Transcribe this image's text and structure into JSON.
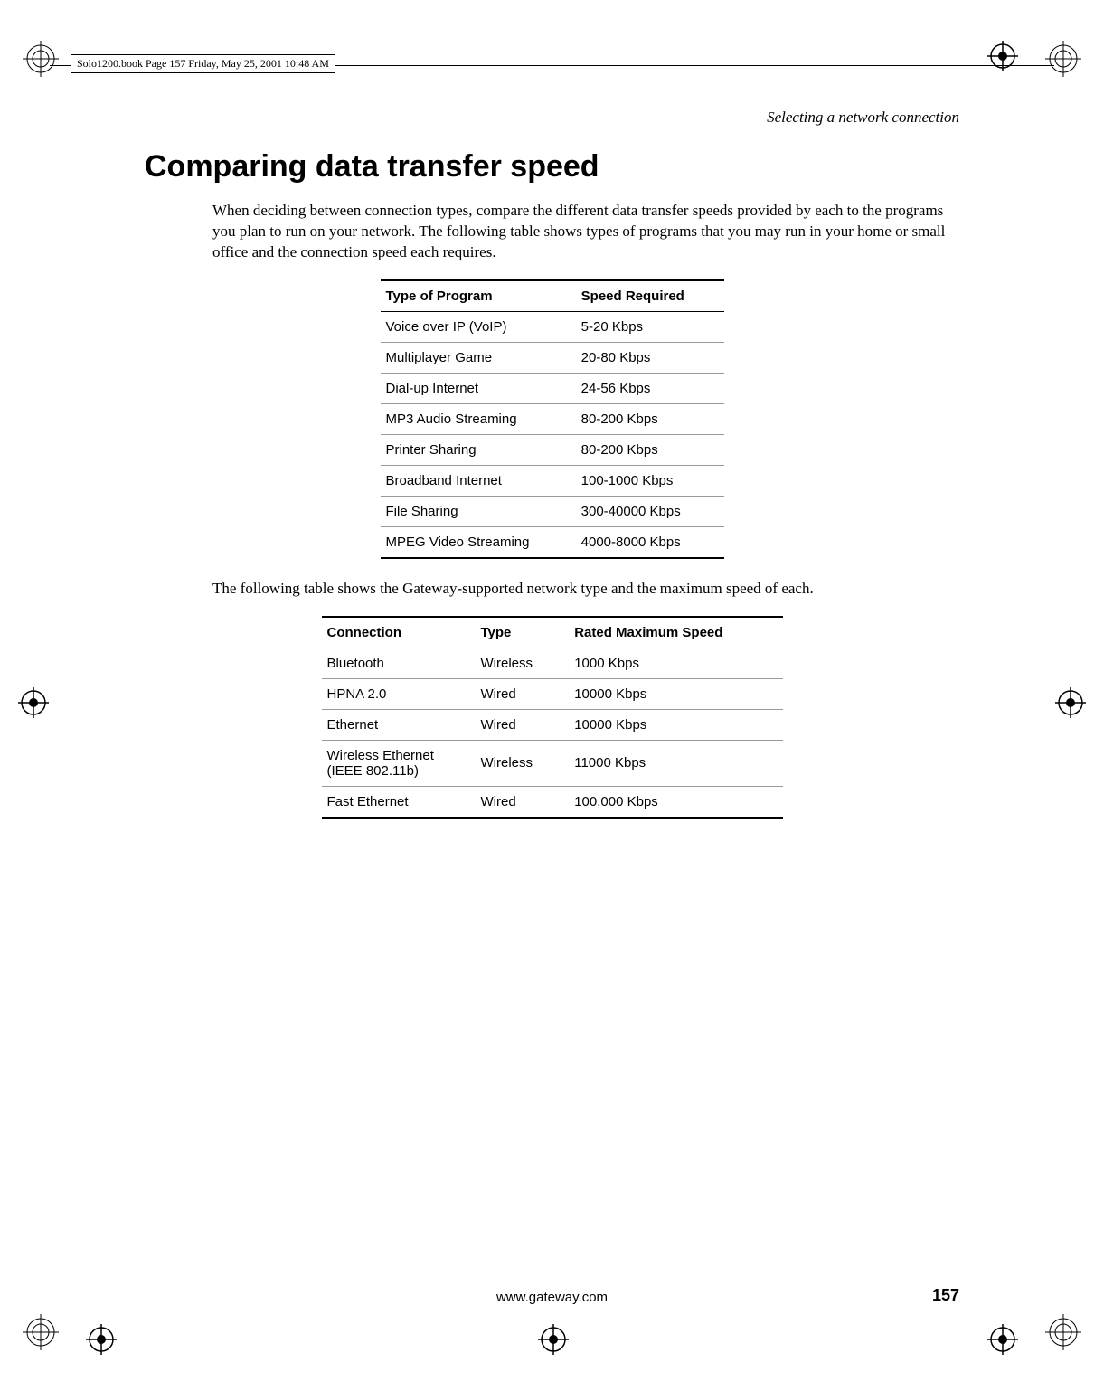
{
  "header_tag": "Solo1200.book  Page 157  Friday, May 25, 2001  10:48 AM",
  "running_header": "Selecting a network connection",
  "main_heading": "Comparing data transfer speed",
  "para1": "When deciding between connection types, compare the different data transfer speeds provided by each to the programs you plan to run on your network. The following table shows types of programs that you may run in your home or small office and the connection speed each requires.",
  "table1": {
    "headers": [
      "Type of Program",
      "Speed Required"
    ],
    "rows": [
      [
        "Voice over IP (VoIP)",
        "5-20 Kbps"
      ],
      [
        "Multiplayer Game",
        "20-80 Kbps"
      ],
      [
        "Dial-up Internet",
        "24-56 Kbps"
      ],
      [
        "MP3 Audio Streaming",
        "80-200 Kbps"
      ],
      [
        "Printer Sharing",
        "80-200 Kbps"
      ],
      [
        "Broadband Internet",
        "100-1000 Kbps"
      ],
      [
        "File Sharing",
        "300-40000 Kbps"
      ],
      [
        "MPEG Video Streaming",
        "4000-8000 Kbps"
      ]
    ]
  },
  "para2": "The following table shows the Gateway-supported network type and the maximum speed of each.",
  "table2": {
    "headers": [
      "Connection",
      "Type",
      "Rated Maximum Speed"
    ],
    "rows": [
      [
        "Bluetooth",
        "Wireless",
        "1000 Kbps"
      ],
      [
        "HPNA 2.0",
        "Wired",
        "10000 Kbps"
      ],
      [
        "Ethernet",
        "Wired",
        "10000 Kbps"
      ],
      [
        "Wireless Ethernet (IEEE 802.11b)",
        "Wireless",
        "11000 Kbps"
      ],
      [
        "Fast Ethernet",
        "Wired",
        "100,000 Kbps"
      ]
    ]
  },
  "footer_url": "www.gateway.com",
  "page_number": "157"
}
